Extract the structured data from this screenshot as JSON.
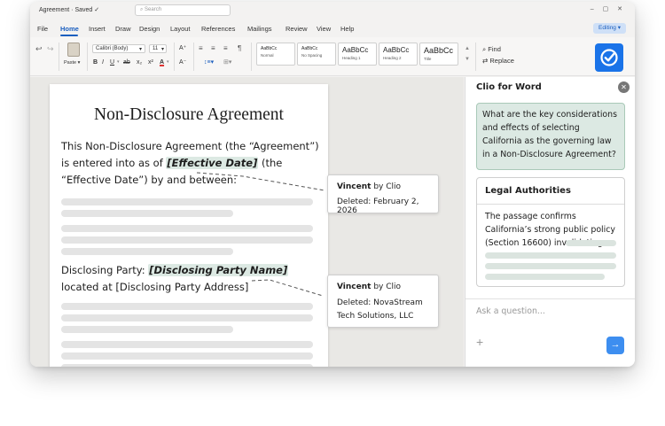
{
  "app": {
    "title": "Agreement · Saved ✓",
    "search_placeholder": "Search",
    "window_controls": "– ▢ ✕",
    "editing_label": "Editing ▾"
  },
  "menu": {
    "items": [
      "File",
      "Home",
      "Insert",
      "Draw",
      "Design",
      "Layout",
      "References",
      "Mailings",
      "Review",
      "View",
      "Help"
    ],
    "active": "Home"
  },
  "ribbon": {
    "paste_label": "Paste ▾",
    "font_name": "Calibri (Body)",
    "font_size": "11",
    "format_buttons": [
      "B",
      "I",
      "U",
      "ab",
      "x₂",
      "x²",
      "A"
    ],
    "styles": [
      {
        "preview": "AaBbCc",
        "name": "Normal"
      },
      {
        "preview": "AaBbCc",
        "name": "No Spacing"
      },
      {
        "preview": "AaBbCc",
        "name": "Heading 1"
      },
      {
        "preview": "AaBbCc",
        "name": "Heading 2"
      },
      {
        "preview": "AaBbCc",
        "name": "Title"
      }
    ],
    "find_label": "Find",
    "replace_label": "Replace",
    "accent": "#1a73e8"
  },
  "document": {
    "title": "Non-Disclosure Agreement",
    "para1_before": "This Non-Disclosure Agreement (the “Agreement”) is entered into as of ",
    "para1_field": "[Effective Date]",
    "para1_after": " (the “Effective Date”) by and between:",
    "para2_before": "Disclosing Party: ",
    "para2_field": "[Disclosing Party Name]",
    "para2_after": " located at [Disclosing Party Address]"
  },
  "comments": [
    {
      "author": "Vincent",
      "suffix": " by Clio",
      "text": "Deleted: February 2, 2026"
    },
    {
      "author": "Vincent",
      "suffix": " by Clio",
      "text": "Deleted: NovaStream Tech Solutions, LLC"
    }
  ],
  "panel": {
    "title": "Clio for Word",
    "question": "What are the key considerations and effects of selecting California as the governing law in a Non-Disclosure Agreement?",
    "card_title": "Legal Authorities",
    "card_text": "The passage confirms California’s strong public policy (Section 16600) invalidating",
    "ask_placeholder": "Ask a question...",
    "accent": "#3d8ef0",
    "highlight": "#dce9e3"
  }
}
